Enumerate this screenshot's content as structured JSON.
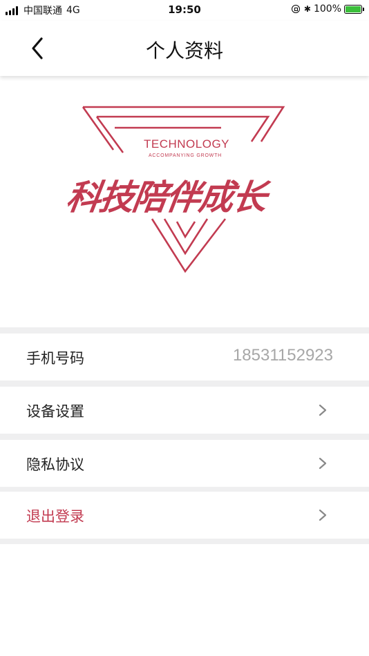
{
  "status_bar": {
    "carrier": "中国联通",
    "network": "4G",
    "time": "19:50",
    "battery": "100%",
    "battery_level": 1.0
  },
  "header": {
    "title": "个人资料"
  },
  "logo": {
    "english": "TECHNOLOGY",
    "tagline": "ACCOMPANYING GROWTH",
    "chinese": "科技陪伴成长",
    "color": "#c23b51"
  },
  "rows": [
    {
      "label": "手机号码",
      "value": "18531152923"
    },
    {
      "label": "设备设置"
    },
    {
      "label": "隐私协议"
    },
    {
      "label": "退出登录"
    }
  ],
  "colors": {
    "accent": "#c23b51",
    "separator": "#efeff0",
    "value_text": "#a7a7a7"
  }
}
